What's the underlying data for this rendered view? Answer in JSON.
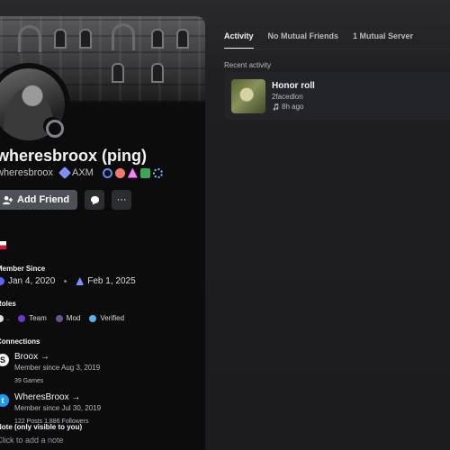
{
  "profile": {
    "display_name": "wheresbroox (ping)",
    "username": "wheresbroox",
    "server_tag": "AXM",
    "badges": [
      "server-boost-icon",
      "heart-badge-icon",
      "hypesquad-icon",
      "hashtag-badge-icon",
      "nitro-badge-icon"
    ],
    "actions": {
      "add_friend_label": "Add Friend",
      "message_icon": "chat-bubble-icon",
      "more_icon": "ellipsis-icon"
    },
    "flag": "flag-indonesia-icon",
    "member_since": {
      "label": "Member Since",
      "discord_date": "Jan 4, 2020",
      "server_date": "Feb 1, 2025"
    },
    "roles": {
      "label": "Roles",
      "items": [
        {
          "name": ".",
          "color": "#dbdee1"
        },
        {
          "name": "Team",
          "color": "#6a39c4"
        },
        {
          "name": "Mod",
          "color": "#6b4f8f"
        },
        {
          "name": "Verified",
          "color": "#58b4f0"
        }
      ]
    },
    "connections": {
      "label": "Connections",
      "items": [
        {
          "name": "Broox →",
          "since": "Member since Aug 3, 2019",
          "stats": "39 Games",
          "icon": "steam-icon"
        },
        {
          "name": "WheresBroox →",
          "since": "Member since Jul 30, 2019",
          "stats": "122 Posts   1,886 Followers",
          "icon": "twitter-icon"
        }
      ]
    },
    "note": {
      "label": "Note (only visible to you)",
      "placeholder": "Click to add a note"
    }
  },
  "tabs": [
    "Activity",
    "No Mutual Friends",
    "1 Mutual Server"
  ],
  "activity": {
    "section_label": "Recent activity",
    "card": {
      "title": "Honor roll",
      "artist": "2facedlon",
      "time": "8h ago"
    }
  },
  "colors": {
    "background": "#1a1a1e",
    "profile_panel": "#0c0c0d",
    "card": "#232428",
    "add_friend_button": "#4e5058"
  }
}
